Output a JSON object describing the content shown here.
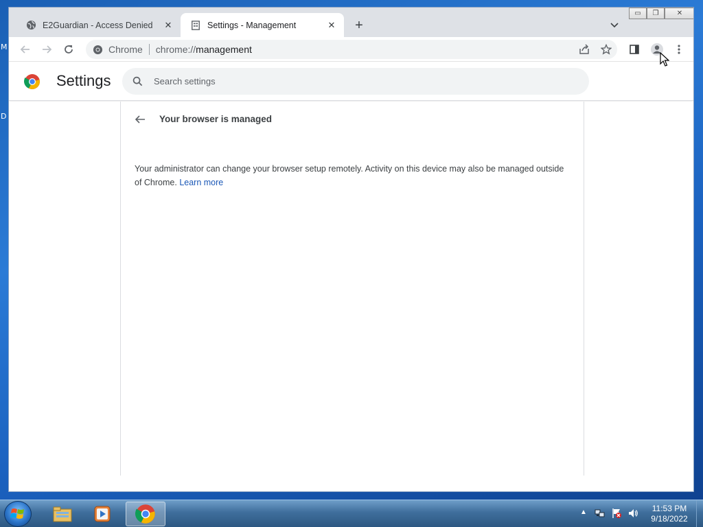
{
  "desktop": {
    "left_fragments": [
      "M",
      "D"
    ]
  },
  "tabs": [
    {
      "title": "E2Guardian - Access Denied",
      "icon": "globe-icon",
      "close": "✕",
      "active": false
    },
    {
      "title": "Settings - Management",
      "icon": "document-icon",
      "close": "✕",
      "active": true
    }
  ],
  "tabstrip": {
    "new_tab": "+",
    "window_buttons": {
      "minimize": "▭",
      "restore": "❐",
      "close": "✕"
    }
  },
  "toolbar": {
    "chip_label": "Chrome",
    "url_scheme": "chrome://",
    "url_host": "management"
  },
  "settings": {
    "title": "Settings",
    "search_placeholder": "Search settings"
  },
  "management": {
    "section_title": "Your browser is managed",
    "description": "Your administrator can change your browser setup remotely. Activity on this device may also be managed outside of Chrome.",
    "learn_more": "Learn more"
  },
  "taskbar": {
    "time": "11:53 PM",
    "date": "9/18/2022",
    "tray_arrow": "▲"
  },
  "colors": {
    "link": "#1a57b6",
    "tabstrip_bg": "#dee1e6",
    "omnibox_bg": "#f1f3f4"
  }
}
